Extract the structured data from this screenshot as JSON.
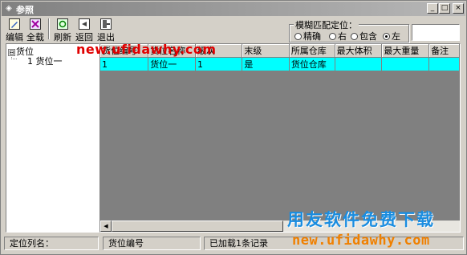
{
  "window": {
    "title": "参照",
    "controls": [
      "_",
      "□",
      "×"
    ]
  },
  "toolbar": {
    "items": [
      {
        "label": "编辑",
        "icon": "edit-icon"
      },
      {
        "label": "全载",
        "icon": "load-all-icon"
      },
      {
        "label": "刷新",
        "icon": "refresh-icon"
      },
      {
        "label": "返回",
        "icon": "return-icon"
      },
      {
        "label": "退出",
        "icon": "exit-icon"
      }
    ]
  },
  "fuzzy_match": {
    "title": "模糊匹配定位：",
    "options": [
      {
        "label": "精确",
        "selected": false
      },
      {
        "label": "右",
        "selected": false
      },
      {
        "label": "包含",
        "selected": false
      },
      {
        "label": "左",
        "selected": true
      }
    ],
    "search_value": ""
  },
  "tree": {
    "root": {
      "toggle": "⊟",
      "label": "货位"
    },
    "child": {
      "label": "1 货位一"
    }
  },
  "grid": {
    "columns": [
      "货位编号",
      "货位名称",
      "级次",
      "末级",
      "所属仓库",
      "最大体积",
      "最大重量",
      "备注"
    ],
    "rows": [
      [
        "1",
        "货位一",
        "1",
        "是",
        "货位仓库",
        "",
        "",
        ""
      ]
    ]
  },
  "status": {
    "column_label": "定位列名：",
    "column_value": "货位编号",
    "loaded": "已加载1条记录"
  },
  "watermark": {
    "top": "new.ufidawhy.com",
    "brand": "用友软件免费下载",
    "url": "new.ufidawhy.com"
  }
}
